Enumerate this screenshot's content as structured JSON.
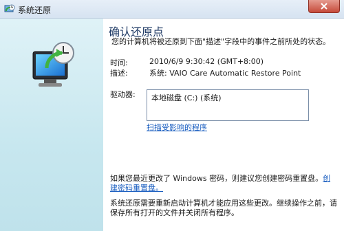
{
  "window": {
    "title": "系统还原",
    "colors": {
      "accent": "#1e3964",
      "link": "#1a5ec0",
      "side_panel": "#c7e7ef",
      "close": "#c64a3a"
    }
  },
  "icons": {
    "app": "system-restore-icon",
    "close": "close-icon",
    "monitor": "monitor-restore-icon"
  },
  "main": {
    "heading": "确认还原点",
    "description": "您的计算机将被还原到下面\"描述\"字段中的事件之前所处的状态。",
    "time_label": "时间:",
    "time_value": "2010/6/9 9:30:42 (GMT+8:00)",
    "desc_label": "描述:",
    "desc_value": "系统: VAIO Care Automatic Restore Point",
    "drives_label": "驱动器:",
    "drives": [
      "本地磁盘 (C:) (系统)"
    ],
    "scan_link": "扫描受影响的程序",
    "note_password_text": "如果您最近更改了 Windows 密码，则建议您创建密码重置盘。",
    "note_password_link": "创建密码重置盘。",
    "note_restart": "系统还原需要重新启动计算机才能应用这些更改。继续操作之前，请保存所有打开的文件并关闭所有程序。"
  }
}
